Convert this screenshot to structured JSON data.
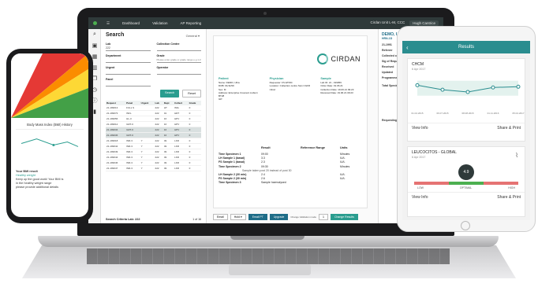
{
  "app": {
    "nav": [
      "Dashboard",
      "Validation",
      "AP Reporting"
    ],
    "location": "Cirdan Unit L-M, CCC",
    "user": "Hugh Cantrice"
  },
  "search": {
    "title": "Search",
    "mode": "General",
    "lab_label": "Lab",
    "lab_value": "222",
    "collection_label": "Collection Centre",
    "department_label": "Department",
    "grade_label": "Grade",
    "grade_hint": "Please enter grade or grade range e.g.1-3",
    "urgent_label": "Urgent",
    "operator_label": "Operator",
    "panel_label": "Panel",
    "search_button": "Search",
    "reset_button": "Reset",
    "columns": [
      "Request",
      "Panel",
      "Urgent",
      "Lab",
      "Dept",
      "Collect",
      "Grade"
    ],
    "rows": [
      [
        "21-199013",
        "FULL S",
        "",
        "222",
        "HT",
        "IMG",
        "0"
      ],
      [
        "21-199073",
        "INFL",
        "",
        "222",
        "01",
        "HRT",
        "0"
      ],
      [
        "21-199056",
        "HL-3",
        "",
        "222",
        "16",
        "HPV",
        "0"
      ],
      [
        "21-199012",
        "GRT-0",
        "",
        "222",
        "16",
        "HPV",
        "0"
      ],
      [
        "21-199034",
        "GRT-0",
        "",
        "222",
        "16",
        "HPV",
        "0"
      ],
      [
        "21-199036",
        "GRT-0",
        "",
        "222",
        "16",
        "HPV",
        "0"
      ],
      [
        "21-199018",
        "INR-3",
        "Y",
        "222",
        "49",
        "LKR",
        "0"
      ],
      [
        "21-199042",
        "INR-3",
        "Y",
        "222",
        "49",
        "LKR",
        "0"
      ],
      [
        "21-199049",
        "INR-3",
        "Y",
        "222",
        "49",
        "LKR",
        "0"
      ],
      [
        "21-199044",
        "INR-3",
        "Y",
        "222",
        "49",
        "LKR",
        "0"
      ],
      [
        "21-199046",
        "INR-3",
        "Y",
        "222",
        "49",
        "LKR",
        "0"
      ],
      [
        "21-199047",
        "INR-3",
        "Y",
        "222",
        "49",
        "LKR",
        "0"
      ]
    ],
    "selected_rows": [
      4,
      5
    ],
    "footer": "Search Criteria Lab: 222",
    "page": "1 of 16"
  },
  "report": {
    "logo": "CIRDAN",
    "patient_hd": "Patient",
    "patient_lines": [
      "Name: DEMO, Ultra",
      "DOB: 01/11/99",
      "Sex: M",
      "Address: Enterprise Crescent Lisburn BT28",
      "GP:"
    ],
    "physician_hd": "Physician",
    "physician_lines": [
      "Requester: FS ETRIC",
      "Location: Collection centre Swn CGFR",
      "Clinic:"
    ],
    "sample_hd": "Sample",
    "sample_lines": [
      "Lab ID: 21 - 199056",
      "Order Date: 19.06.21",
      "Collection Date: 19.06.21 09:23",
      "Received Date: 19.06.21 09:23"
    ],
    "col_result": "Result",
    "col_range": "Reference Range",
    "col_units": "Units",
    "results": [
      {
        "name": "Time Specimen 1",
        "value": "09:00",
        "range": "",
        "units": "Minutes"
      },
      {
        "name": "LH Sample 1 (basal)",
        "value": "3.3",
        "range": "",
        "units": "IU/L"
      },
      {
        "name": "FS Sample 1 (basal)",
        "value": "2.3",
        "range": "",
        "units": "IU/L"
      },
      {
        "name": "Time Specimen 2",
        "value": "09:30",
        "range": "",
        "units": "Minutes"
      },
      {
        "name": "Sample taken post 20 instead of post 30",
        "value": "",
        "range": "",
        "units": "",
        "note": true
      },
      {
        "name": "LH Sample 2 (30 min)",
        "value": "2.4",
        "range": "",
        "units": "IU/L"
      },
      {
        "name": "FS Sample 2 (30 min)",
        "value": "2.6",
        "range": "",
        "units": "IU/L"
      },
      {
        "name": "Time Specimen 3",
        "value": "Sample haemolysed",
        "range": "",
        "units": ""
      }
    ],
    "actions": [
      "Email",
      "Hold",
      "Email PT",
      "Upgrade",
      "Change Results"
    ],
    "validation_hd": "Change Validation mode",
    "validation_value": "1"
  },
  "side": {
    "title": "DEMO, Ultra",
    "id": "HRN-1D",
    "lab": "21-1991",
    "lines": [
      "Referrer",
      "Collected on",
      "Sig of Requester",
      "Received",
      "Updated",
      "Programme"
    ],
    "specimen_hd": "Total Specimen",
    "requesting_hd": "Requesting D"
  },
  "phone": {
    "section": "Body Mass Index (BMI) History",
    "card_title": "Your BMI result",
    "card_lines": [
      "Healthy weight",
      "Keep up the good work! Your BMI is",
      "in the healthy weight range",
      "please provide additional details"
    ]
  },
  "tablet": {
    "header": "Results",
    "card1_title": "CHCM",
    "card1_date": "6 Apr 2017",
    "card1_view": "View Info",
    "card1_share": "Share & Print",
    "card2_title": "LEUCOCITOS - GLOBAL",
    "card2_date": "6 Apr 2017",
    "card2_value": "4.9",
    "card2_view": "View Info",
    "card2_share": "Share & Print",
    "gauge_labels": [
      "LOW",
      "OPTIMAL",
      "HIGH"
    ],
    "accent": "#2a8d8f"
  },
  "chart_data": {
    "type": "line",
    "x": [
      "01.04.2015",
      "06.07.2015",
      "08.08.2015",
      "01.11.2016",
      "05.04.2017"
    ],
    "series": [
      {
        "values": [
          33.8,
          33.2,
          32.9,
          33.5,
          33.6
        ]
      }
    ],
    "ylim": [
      31,
      35
    ]
  }
}
